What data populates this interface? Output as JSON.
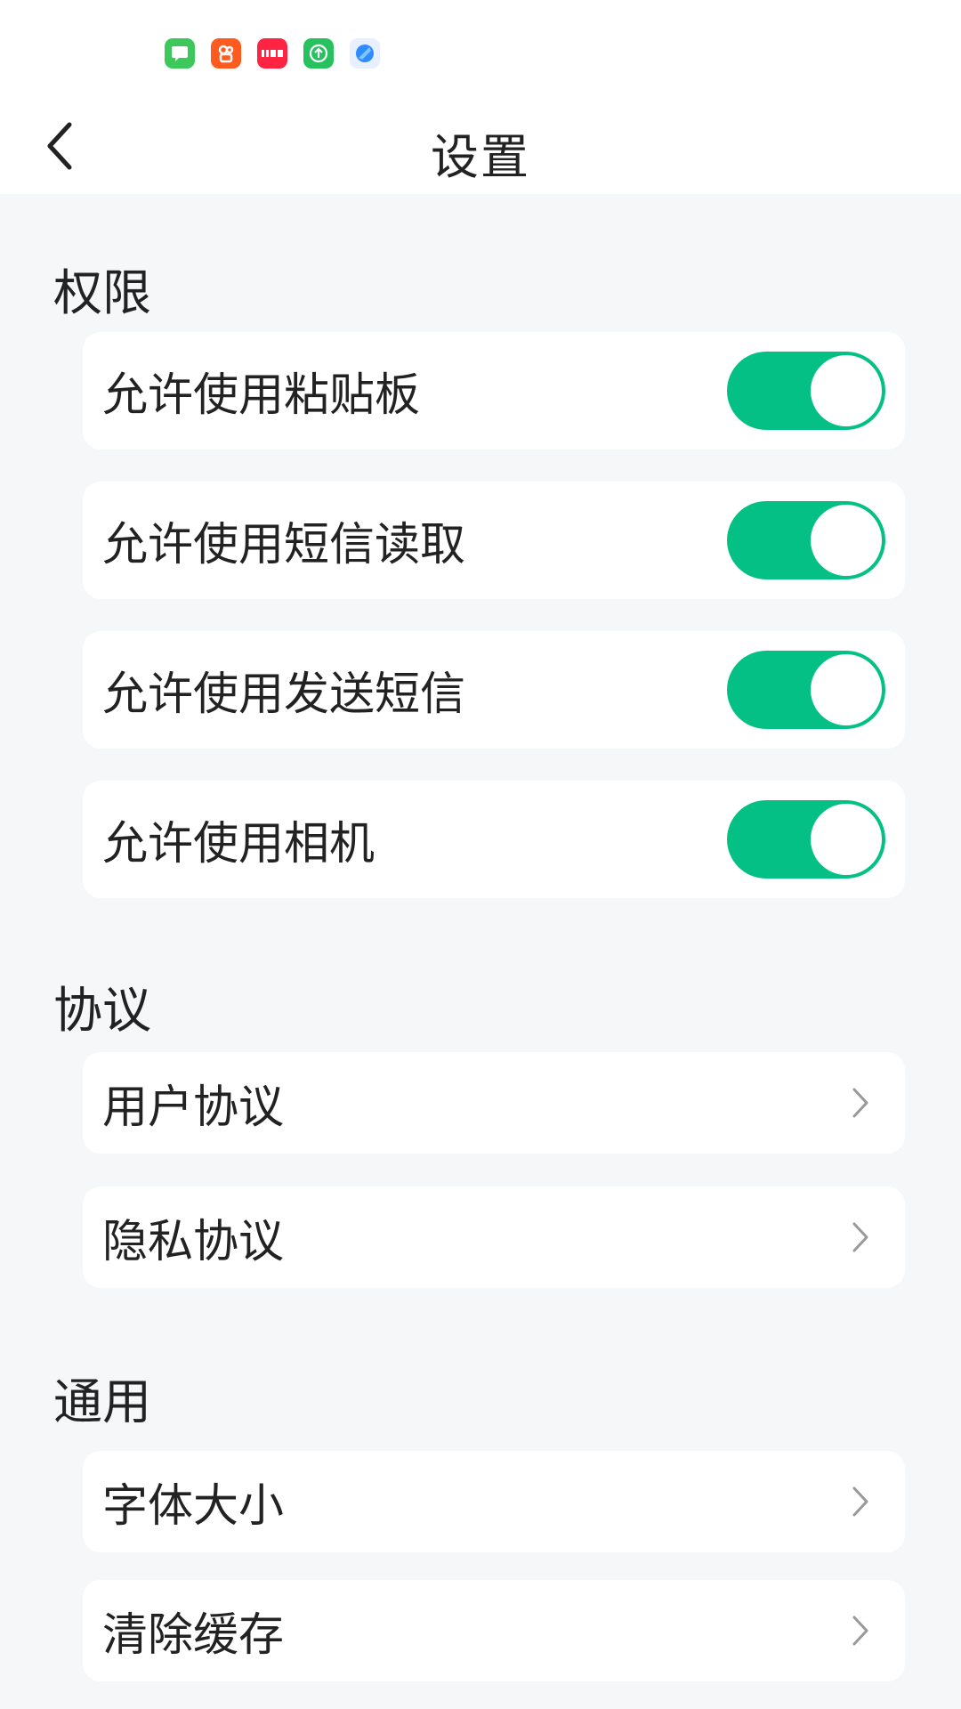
{
  "status_bar": {
    "apps": [
      {
        "icon": "messages-icon",
        "color": "#3cc85a",
        "glyph": "▭"
      },
      {
        "icon": "kuaishou-icon",
        "color": "#ff5a1f",
        "glyph": "✿"
      },
      {
        "icon": "xiaohongshu-icon",
        "color": "#ff2442",
        "glyph": "小红书"
      },
      {
        "icon": "upload-icon",
        "color": "#27c25f",
        "glyph": "↑"
      },
      {
        "icon": "browser-icon",
        "color": "#2d8cff",
        "glyph": "●"
      }
    ]
  },
  "header": {
    "title": "设置"
  },
  "sections": {
    "permissions": {
      "title": "权限",
      "items": [
        {
          "label": "允许使用粘贴板",
          "enabled": true
        },
        {
          "label": "允许使用短信读取",
          "enabled": true
        },
        {
          "label": "允许使用发送短信",
          "enabled": true
        },
        {
          "label": "允许使用相机",
          "enabled": true
        }
      ]
    },
    "agreements": {
      "title": "协议",
      "items": [
        {
          "label": "用户协议"
        },
        {
          "label": "隐私协议"
        }
      ]
    },
    "general": {
      "title": "通用",
      "items": [
        {
          "label": "字体大小"
        },
        {
          "label": "清除缓存"
        }
      ]
    }
  },
  "colors": {
    "accent": "#04c084",
    "background": "#f6f7f9",
    "card": "#ffffff"
  }
}
